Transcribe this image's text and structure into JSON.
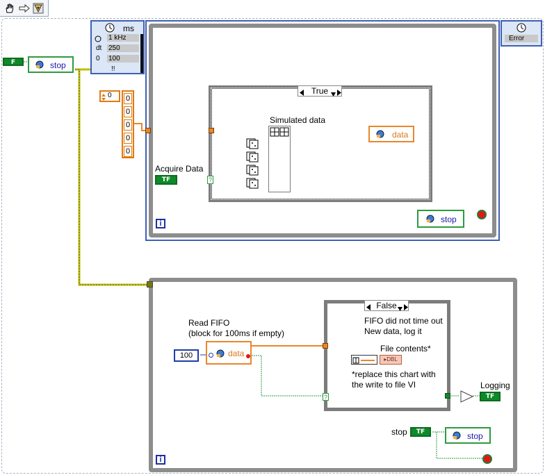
{
  "toolbar": {
    "icons": [
      "hand-icon",
      "arrow-right-icon",
      "run-icon"
    ]
  },
  "left": {
    "stop_false_label": "F",
    "stop_shared_var": "stop",
    "control_value": "0",
    "array_values": [
      "0",
      "0",
      "0",
      "0",
      "0"
    ]
  },
  "timed_loop_node": {
    "unit": "ms",
    "rows": [
      {
        "icon": "source-icon",
        "value": "1 kHz"
      },
      {
        "label": "dt",
        "value": "250"
      },
      {
        "label": "0",
        "value": "100"
      }
    ],
    "more": "!!"
  },
  "timed_loop_output": {
    "error_label": "Error"
  },
  "top_loop": {
    "case_selector": "True",
    "simulated_label": "Simulated data",
    "acquire_label": "Acquire Data",
    "acquire_tf": "TF",
    "data_var": "data",
    "stop_var": "stop",
    "iteration": "i"
  },
  "bottom_loop": {
    "read_fifo_label_1": "Read FIFO",
    "read_fifo_label_2": "(block for 100ms if empty)",
    "timeout_value": "100",
    "data_var": "data",
    "case_selector": "False",
    "case_text_1": "FIFO did not time out",
    "case_text_2": "New data, log it",
    "file_contents_label": "File contents*",
    "replace_note_1": "*replace this chart with",
    "replace_note_2": "the write to file VI",
    "logging_label": "Logging",
    "logging_tf": "TF",
    "stop_label": "stop",
    "stop_tf": "TF",
    "stop_var": "stop",
    "iteration": "i"
  },
  "colors": {
    "orange_wire": "#e8872a",
    "green_wire": "#2e9a3e",
    "loop_frame": "#8d8d8d",
    "timed_loop_border": "#3e5fb4",
    "error_cluster": "#bfbf00"
  }
}
